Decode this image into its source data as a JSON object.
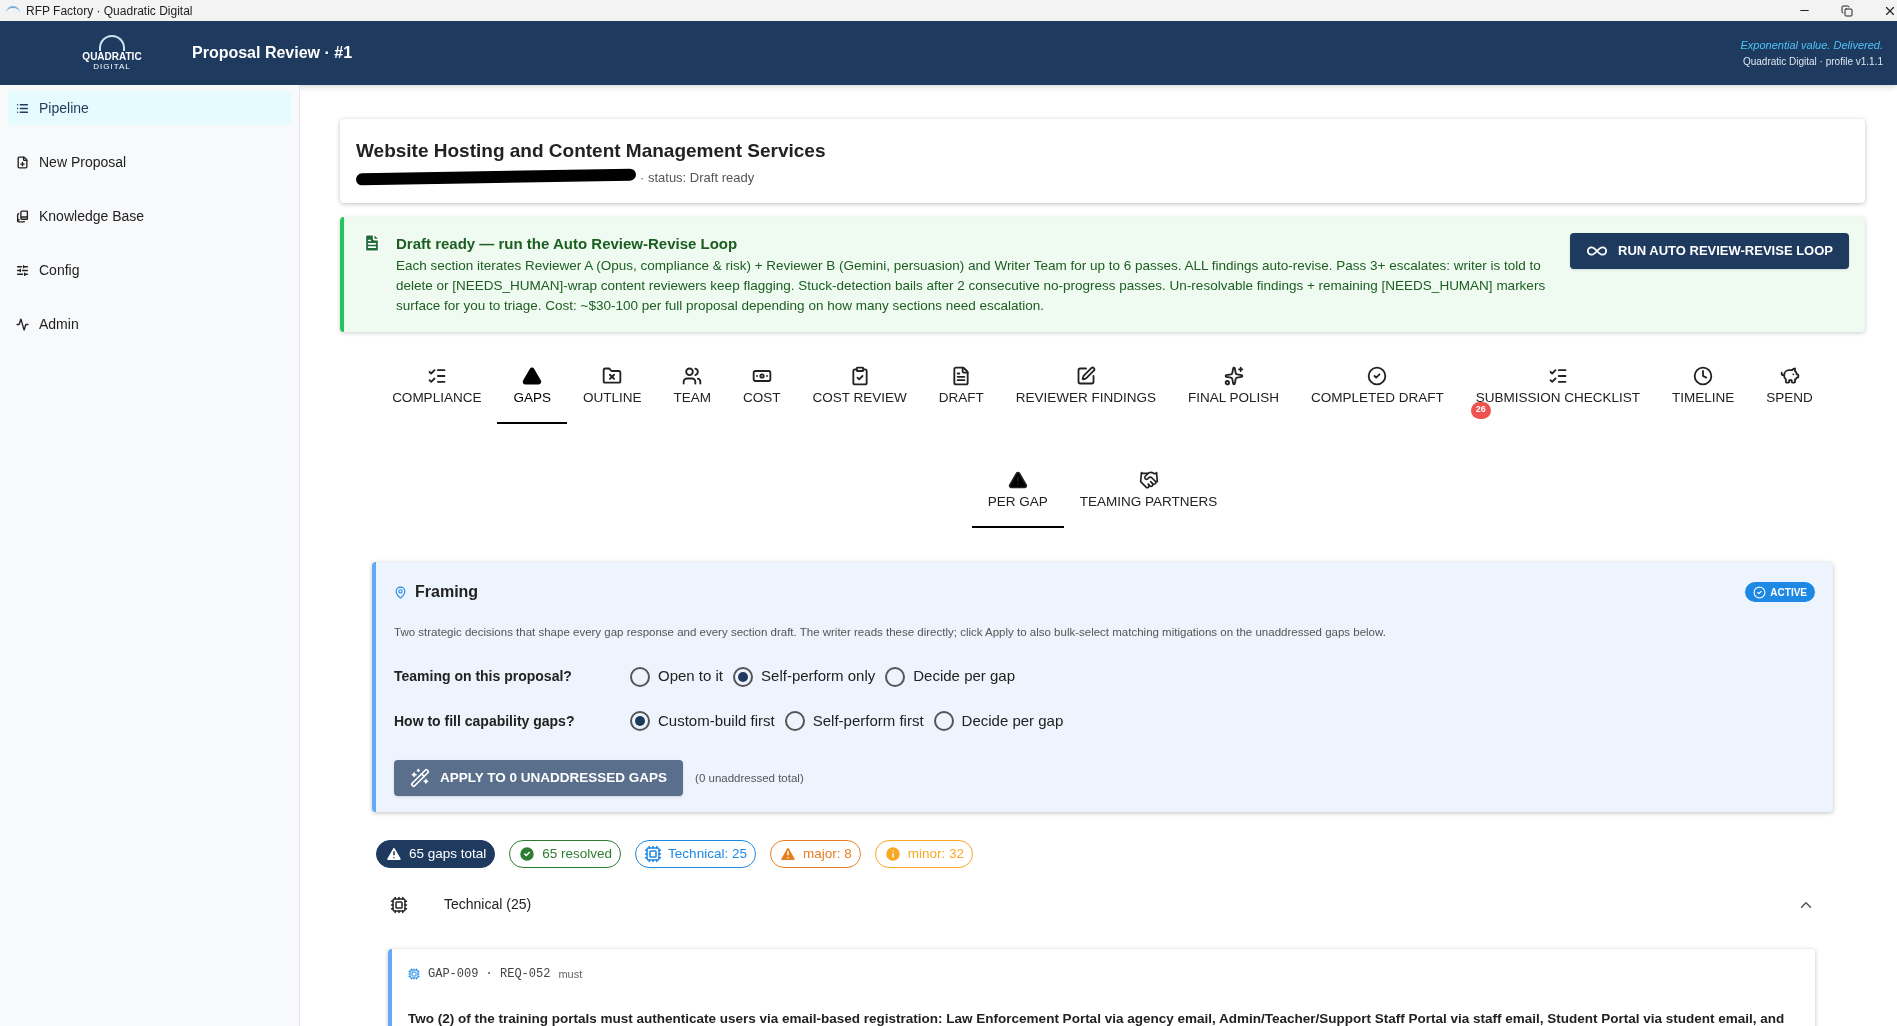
{
  "window": {
    "title": "RFP Factory · Quadratic Digital"
  },
  "header": {
    "logo_top": "QUADRATIC",
    "logo_bottom": "DIGITAL",
    "title": "Proposal Review · #1",
    "tagline": "Exponential value. Delivered.",
    "profile": "Quadratic Digital · profile v1.1.1"
  },
  "sidebar": {
    "items": [
      {
        "label": "Pipeline",
        "kind": "list",
        "selected": true
      },
      {
        "label": "New Proposal",
        "kind": "new",
        "selected": false
      },
      {
        "label": "Knowledge Base",
        "kind": "book",
        "selected": false
      },
      {
        "label": "Config",
        "kind": "sliders",
        "selected": false
      },
      {
        "label": "Admin",
        "kind": "admin",
        "selected": false
      }
    ]
  },
  "proposal": {
    "title": "Website Hosting and Content Management Services",
    "meta": "· status: Draft ready"
  },
  "notice": {
    "title": "Draft ready — run the Auto Review-Revise Loop",
    "body": "Each section iterates Reviewer A (Opus, compliance & risk) + Reviewer B (Gemini, persuasion) and Writer Team for up to 6 passes. ALL findings auto-revise. Pass 3+ escalates: writer is told to delete or [NEEDS_HUMAN]-wrap content reviewers keep flagging. Stuck-detection bails after 2 consecutive no-progress passes. Un-resolvable findings + remaining [NEEDS_HUMAN] markers surface for you to triage. Cost: ~$30-100 per full proposal depending on how many sections need escalation.",
    "button": "RUN AUTO REVIEW-REVISE LOOP"
  },
  "tabs": [
    {
      "label": "COMPLIANCE",
      "kind": "compliance",
      "selected": false
    },
    {
      "label": "GAPS",
      "kind": "gaps",
      "selected": true
    },
    {
      "label": "OUTLINE",
      "kind": "outline",
      "selected": false
    },
    {
      "label": "TEAM",
      "kind": "team",
      "selected": false
    },
    {
      "label": "COST",
      "kind": "cost",
      "selected": false
    },
    {
      "label": "COST REVIEW",
      "kind": "costreview",
      "selected": false
    },
    {
      "label": "DRAFT",
      "kind": "draft",
      "selected": false
    },
    {
      "label": "REVIEWER FINDINGS",
      "kind": "findings",
      "selected": false
    },
    {
      "label": "FINAL POLISH",
      "kind": "polish",
      "selected": false
    },
    {
      "label": "COMPLETED DRAFT",
      "kind": "completed",
      "selected": false
    },
    {
      "label": "SUBMISSION CHECKLIST",
      "kind": "checklist",
      "selected": false,
      "badge": "26"
    },
    {
      "label": "TIMELINE",
      "kind": "timeline",
      "selected": false
    },
    {
      "label": "SPEND",
      "kind": "spend",
      "selected": false
    }
  ],
  "subtabs": [
    {
      "label": "PER GAP",
      "kind": "gaps",
      "selected": true
    },
    {
      "label": "TEAMING PARTNERS",
      "kind": "handshake",
      "selected": false
    }
  ],
  "framing": {
    "title": "Framing",
    "status": "ACTIVE",
    "description": "Two strategic decisions that shape every gap response and every section draft. The writer reads these directly; click Apply to also bulk-select matching mitigations on the unaddressed gaps below.",
    "questions": [
      {
        "label": "Teaming on this proposal?",
        "options": [
          {
            "label": "Open to it",
            "selected": false
          },
          {
            "label": "Self-perform only",
            "selected": true
          },
          {
            "label": "Decide per gap",
            "selected": false
          }
        ]
      },
      {
        "label": "How to fill capability gaps?",
        "options": [
          {
            "label": "Custom-build first",
            "selected": true
          },
          {
            "label": "Self-perform first",
            "selected": false
          },
          {
            "label": "Decide per gap",
            "selected": false
          }
        ]
      }
    ],
    "apply_button": "APPLY TO 0 UNADDRESSED GAPS",
    "apply_note": "(0 unaddressed total)"
  },
  "chips": [
    {
      "label": "65 gaps total",
      "kind": "total",
      "color": "#1e3a5f"
    },
    {
      "label": "65 resolved",
      "kind": "resolved",
      "color": "#2e7d32"
    },
    {
      "label": "Technical: 25",
      "kind": "technical",
      "color": "#1e88e5"
    },
    {
      "label": "major: 8",
      "kind": "major",
      "color": "#e67e22"
    },
    {
      "label": "minor: 32",
      "kind": "minor",
      "color": "#f9a825"
    }
  ],
  "group": {
    "label": "Technical (25)",
    "expanded": true
  },
  "gap": {
    "id": "GAP-009 · REQ-052",
    "priority": "must",
    "text": "Two (2) of the training portals must authenticate users via email-based registration: Law Enforcement Portal via agency email, Admin/Teacher/Support Staff Portal via staff email, Student Portal via student email, and"
  }
}
